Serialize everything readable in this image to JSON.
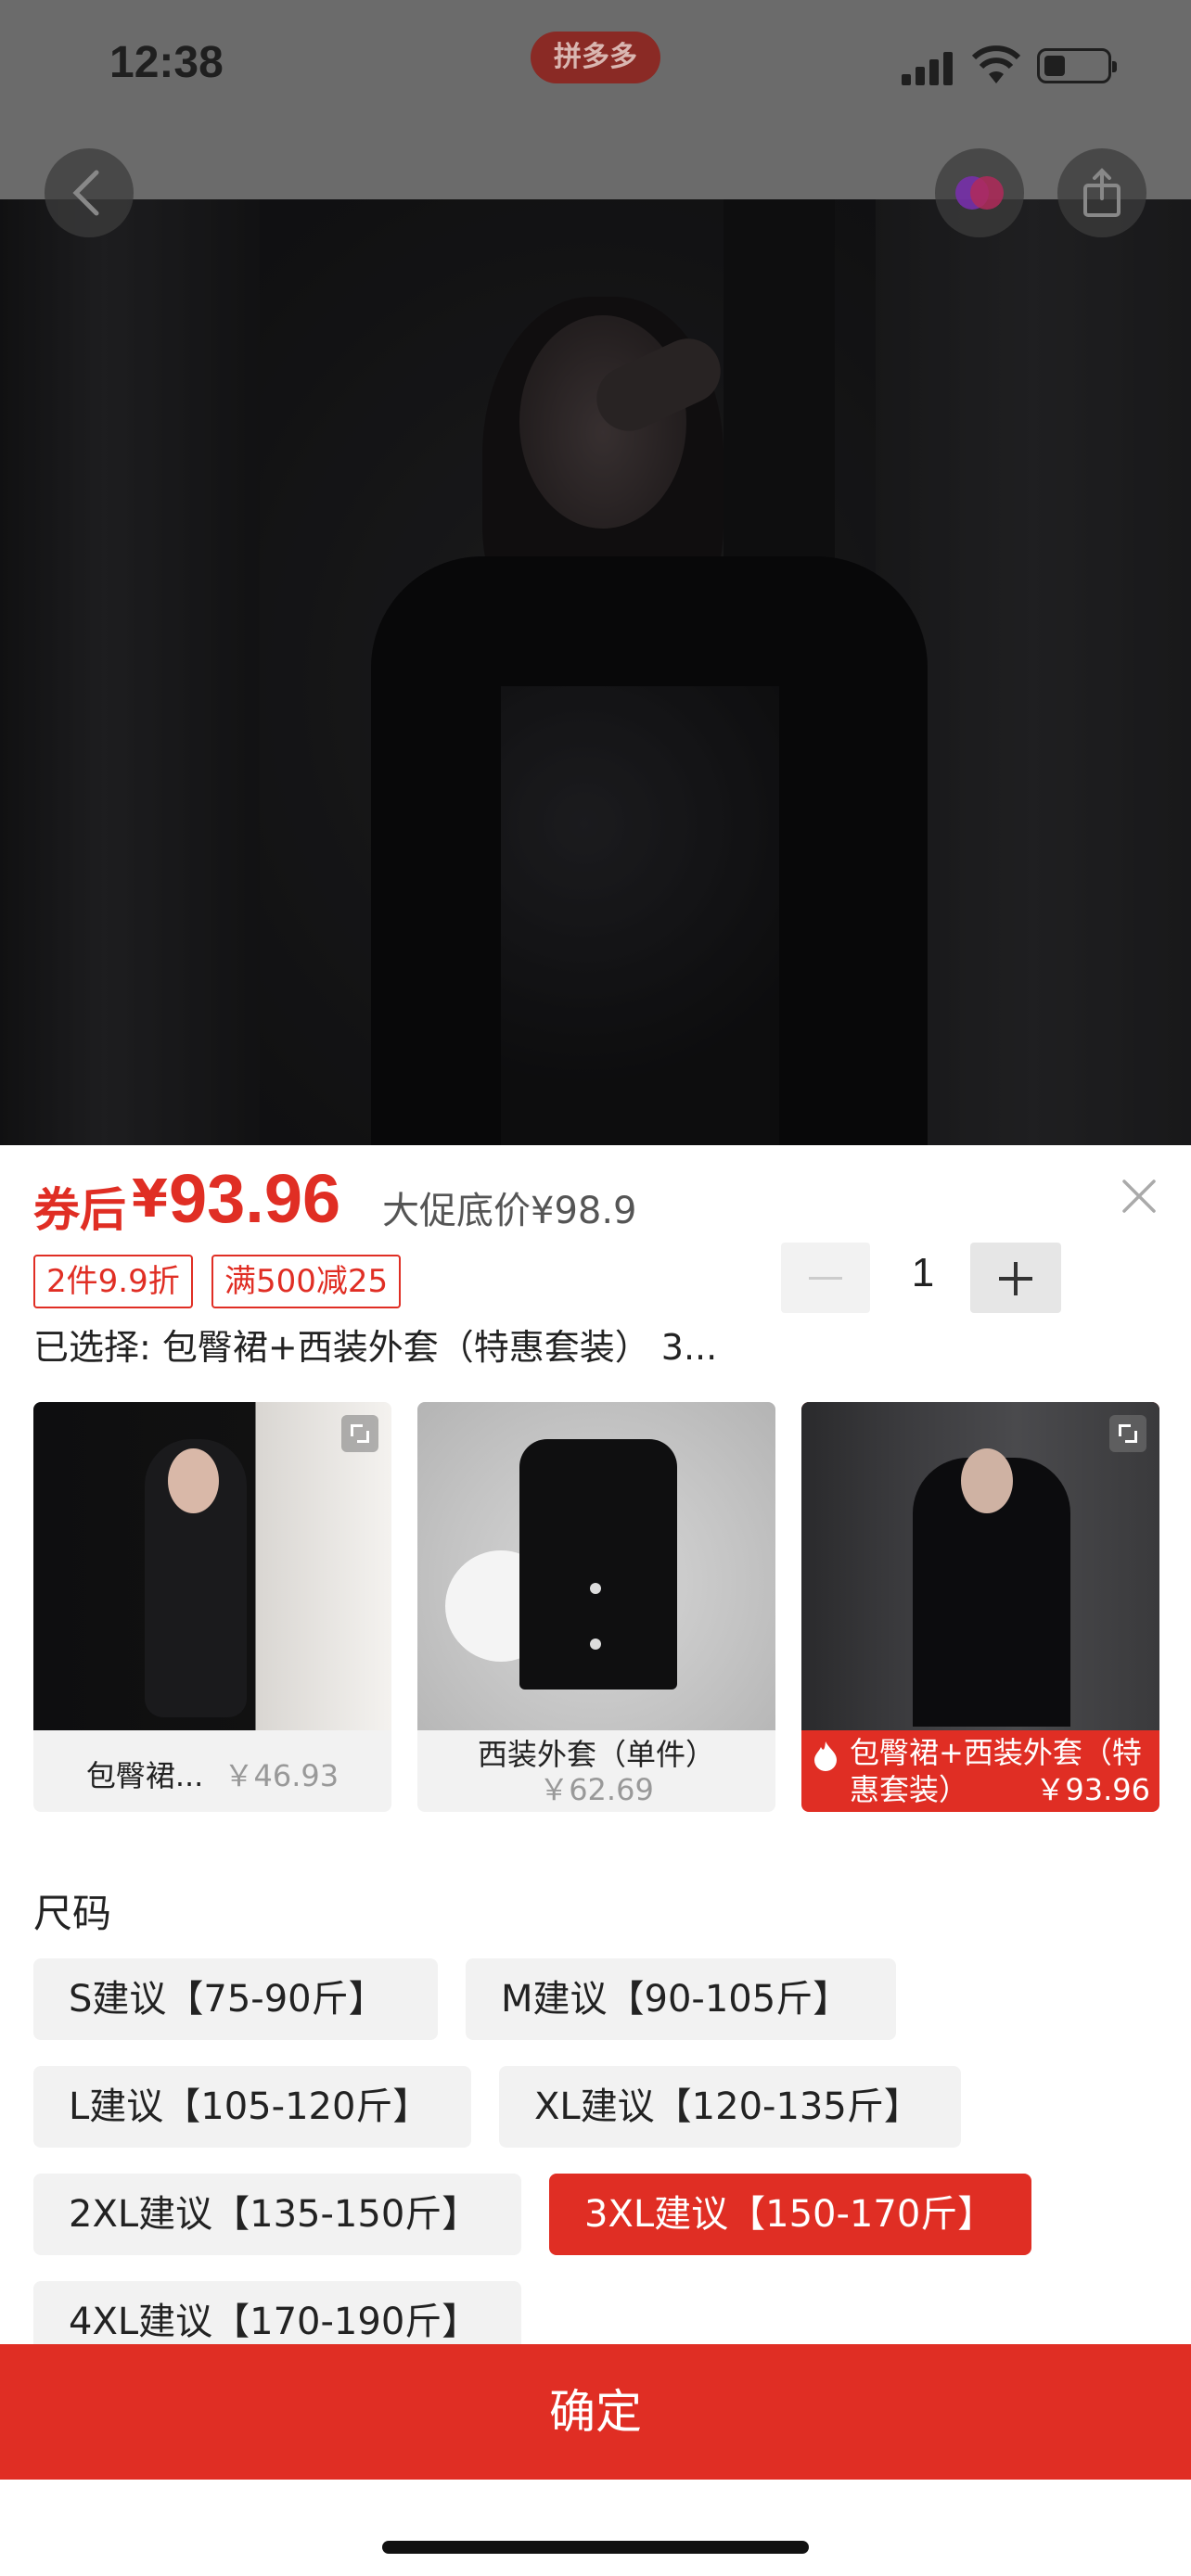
{
  "status_bar": {
    "time": "12:38",
    "app_pill": "拼多多"
  },
  "product": {
    "price_prefix": "券后",
    "currency": "¥",
    "price": "93.96",
    "original_price": "大促底价¥98.9",
    "tags": [
      "2件9.9折",
      "满500减25"
    ],
    "selected_text": "已选择: 包臀裙+西装外套（特惠套装） 3...",
    "quantity": "1"
  },
  "variants": [
    {
      "name": "包臀裙...",
      "price": "￥46.93",
      "active": false
    },
    {
      "name": "西装外套（单件）",
      "price": "￥62.69",
      "active": false
    },
    {
      "name": "包臀裙+西装外套（特惠套装）",
      "price": "￥93.96",
      "active": true
    }
  ],
  "sizes": {
    "title": "尺码",
    "options": [
      "S建议【75-90斤】",
      "M建议【90-105斤】",
      "L建议【105-120斤】",
      "XL建议【120-135斤】",
      "2XL建议【135-150斤】",
      "3XL建议【150-170斤】",
      "4XL建议【170-190斤】"
    ],
    "selected": "3XL建议【150-170斤】"
  },
  "confirm_label": "确定",
  "colors": {
    "accent": "#e02e24",
    "chip_bg": "#f2f2f2"
  }
}
